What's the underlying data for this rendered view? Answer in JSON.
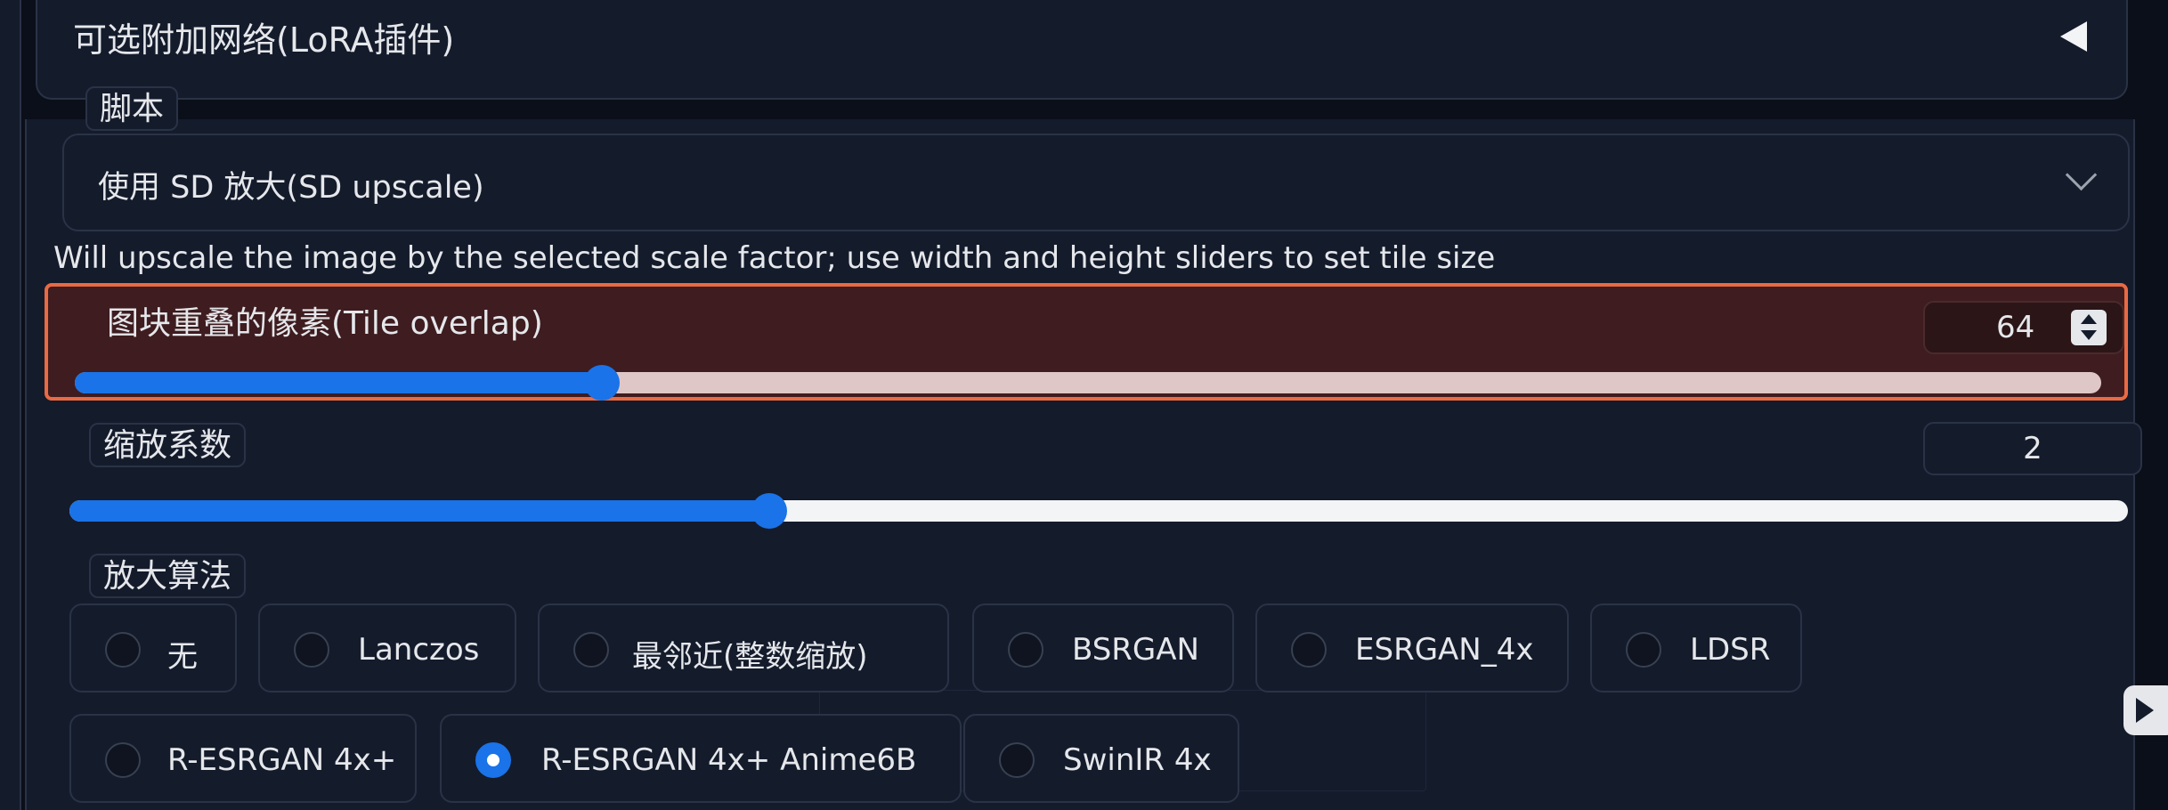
{
  "lora_accordion": {
    "title": "可选附加网络(LoRA插件)"
  },
  "script": {
    "label": "脚本",
    "selected": "使用 SD 放大(SD upscale)"
  },
  "info": "Will upscale the image by the selected scale factor; use width and height sliders to set tile size",
  "tile_overlap": {
    "label": "图块重叠的像素(Tile overlap)",
    "value": "64",
    "fill_fraction": 0.26
  },
  "scale_factor": {
    "label": "缩放系数",
    "value": "2",
    "fill_fraction": 0.34
  },
  "upscaler": {
    "label": "放大算法",
    "selected": "R-ESRGAN 4x+ Anime6B",
    "options": [
      "无",
      "Lanczos",
      "最邻近(整数缩放)",
      "BSRGAN",
      "ESRGAN_4x",
      "LDSR",
      "R-ESRGAN 4x+",
      "R-ESRGAN 4x+ Anime6B",
      "SwinIR 4x"
    ]
  },
  "colors": {
    "background": "#0b0f19",
    "panel": "#141b2b",
    "border": "#2a3246",
    "accent_blue": "#1a73e8",
    "highlight_border": "#e96a43",
    "highlight_fill": "#3e1c1f"
  }
}
